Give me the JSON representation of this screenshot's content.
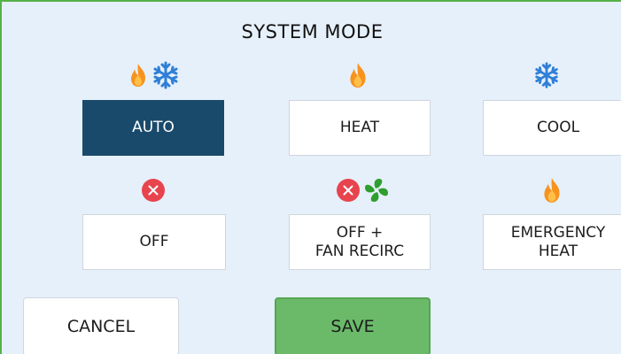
{
  "title": "SYSTEM MODE",
  "modes": [
    {
      "label": "AUTO",
      "selected": true,
      "icons": [
        "flame-icon",
        "snowflake-icon"
      ]
    },
    {
      "label": "HEAT",
      "selected": false,
      "icons": [
        "flame-icon"
      ]
    },
    {
      "label": "COOL",
      "selected": false,
      "icons": [
        "snowflake-icon"
      ]
    },
    {
      "label": "OFF",
      "selected": false,
      "icons": [
        "off-x-icon"
      ]
    },
    {
      "label": "OFF +\nFAN RECIRC",
      "selected": false,
      "icons": [
        "off-x-icon",
        "fan-icon"
      ]
    },
    {
      "label": "EMERGENCY\nHEAT",
      "selected": false,
      "icons": [
        "flame-icon"
      ]
    }
  ],
  "actions": {
    "cancel_label": "CANCEL",
    "save_label": "SAVE"
  },
  "colors": {
    "background": "#e6f0fb",
    "border": "#55b24a",
    "selected": "#1a4a6b",
    "save": "#6aba6a",
    "flame": "#f7931e",
    "snowflake": "#2f7fd6",
    "off": "#e8444d",
    "fan": "#2e9e2e"
  }
}
